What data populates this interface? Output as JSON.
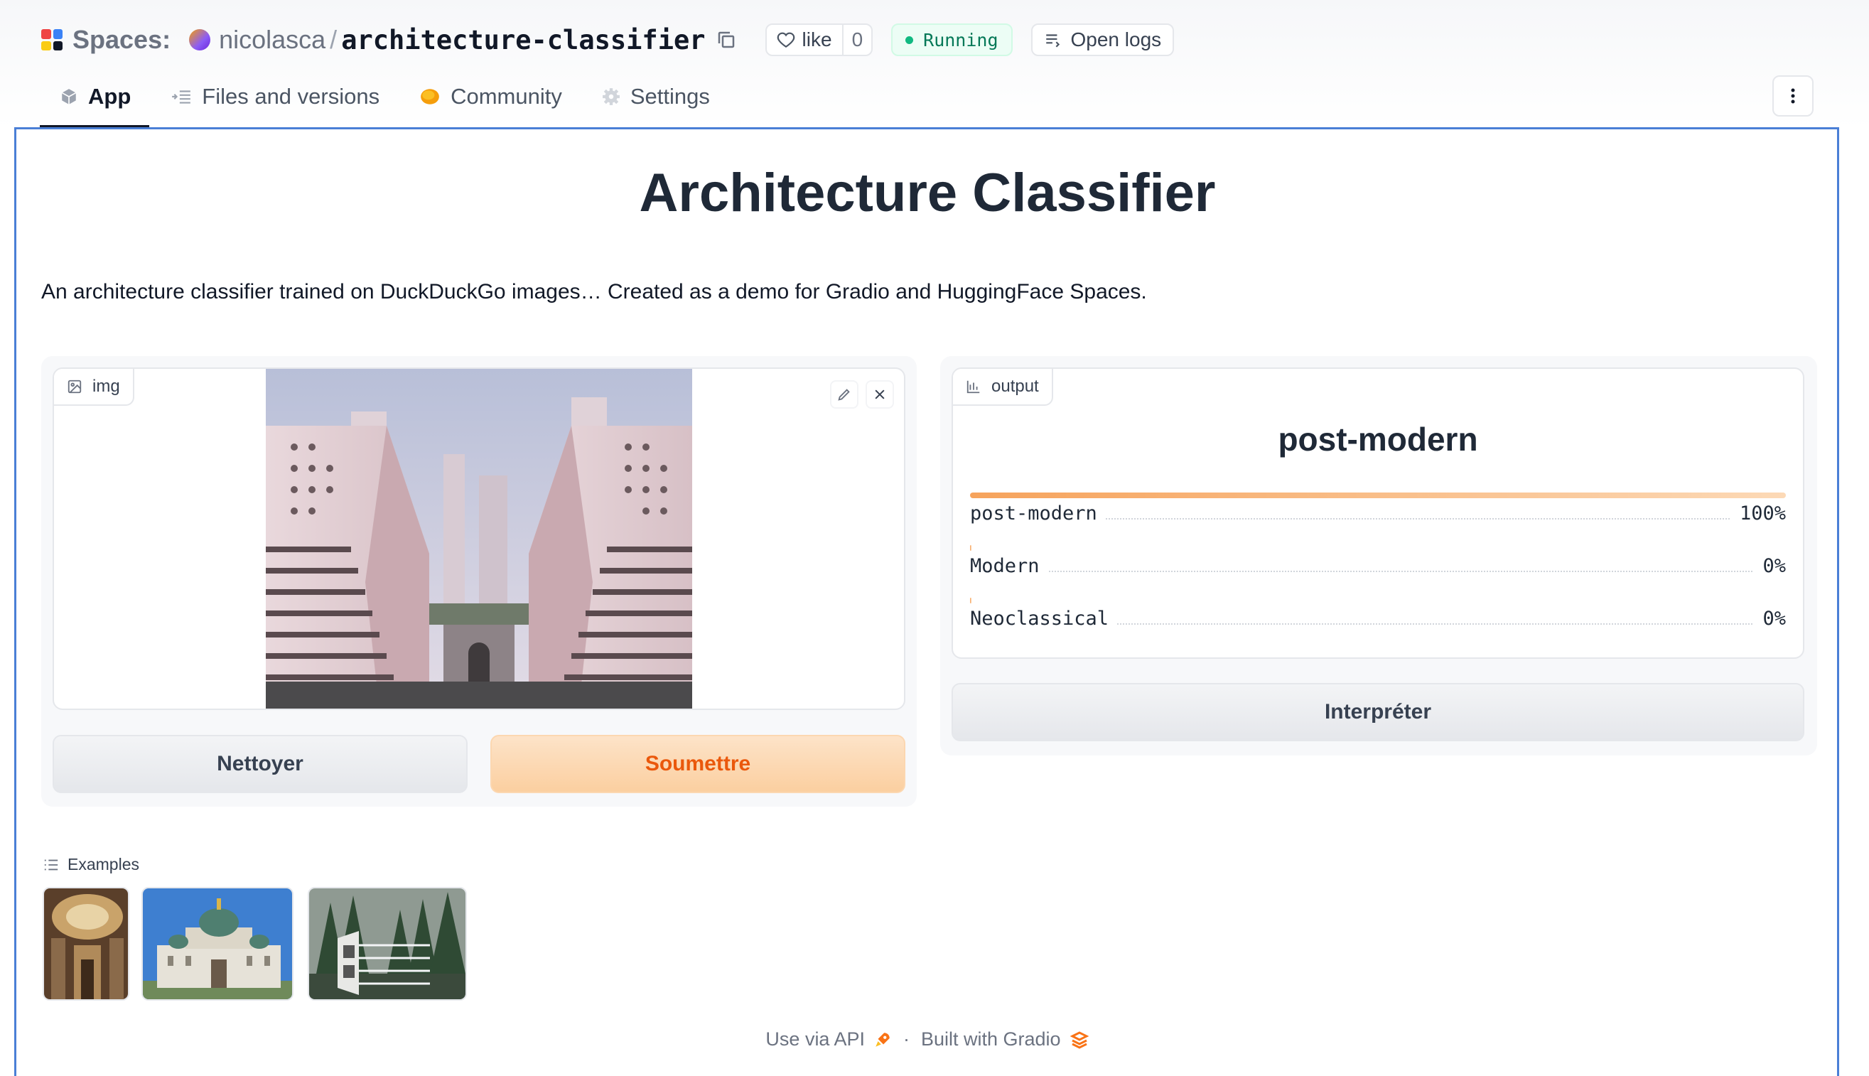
{
  "header": {
    "spaces_label": "Spaces:",
    "owner": "nicolasca",
    "separator": "/",
    "repo": "architecture-classifier",
    "like_label": "like",
    "like_count": "0",
    "status": "Running",
    "status_color": "#10b981",
    "logs_label": "Open logs"
  },
  "tabs": [
    {
      "label": "App",
      "icon": "cube-icon",
      "active": true
    },
    {
      "label": "Files and versions",
      "icon": "files-icon",
      "active": false
    },
    {
      "label": "Community",
      "icon": "community-icon",
      "active": false
    },
    {
      "label": "Settings",
      "icon": "gear-icon",
      "active": false
    }
  ],
  "app": {
    "title": "Architecture Classifier",
    "description": "An architecture classifier trained on DuckDuckGo images… Created as a demo for Gradio and HuggingFace Spaces.",
    "frame_color": "#4a7fd6",
    "input": {
      "label": "img",
      "clear_label": "Nettoyer",
      "submit_label": "Soumettre"
    },
    "output": {
      "label": "output",
      "predicted": "post-modern",
      "confidences": [
        {
          "label": "post-modern",
          "value_text": "100%",
          "value": 1.0
        },
        {
          "label": "Modern",
          "value_text": "0%",
          "value": 0.0
        },
        {
          "label": "Neoclassical",
          "value_text": "0%",
          "value": 0.0
        }
      ],
      "interpret_label": "Interpréter"
    },
    "examples_label": "Examples",
    "examples": [
      "baroque-interior-example",
      "orthodox-cathedral-example",
      "modern-forest-house-example"
    ],
    "accent_color": "#ea580c"
  },
  "footer": {
    "api_label": "Use via API",
    "separator": "·",
    "built_label": "Built with Gradio"
  }
}
